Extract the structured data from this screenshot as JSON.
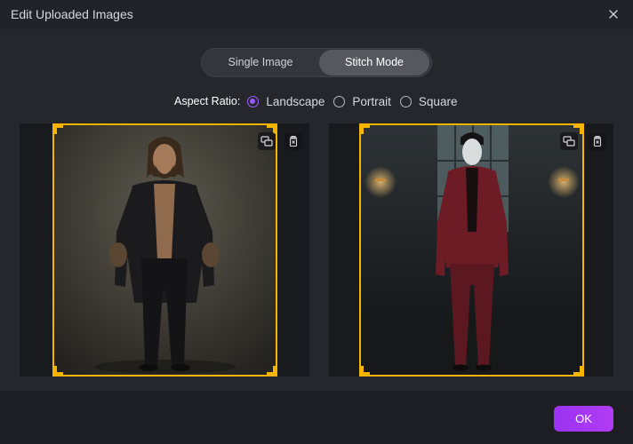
{
  "dialog": {
    "title": "Edit Uploaded Images",
    "close_icon": "close-icon"
  },
  "mode_switch": {
    "single_label": "Single Image",
    "stitch_label": "Stitch Mode",
    "selected": "Stitch Mode"
  },
  "aspect_ratio": {
    "label": "Aspect Ratio:",
    "options": [
      "Landscape",
      "Portrait",
      "Square"
    ],
    "selected": "Landscape"
  },
  "images": [
    {
      "tools": [
        "replace-image-icon",
        "delete-icon"
      ]
    },
    {
      "tools": [
        "replace-image-icon",
        "delete-icon"
      ]
    }
  ],
  "footer": {
    "ok_label": "OK"
  },
  "colors": {
    "accent": "#9b5cff",
    "crop_frame": "#f5b400",
    "ok_button": "#a434f6"
  }
}
